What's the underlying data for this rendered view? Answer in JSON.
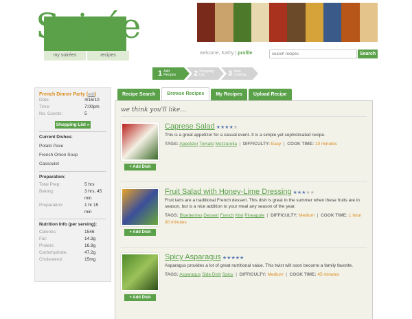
{
  "header": {
    "logo_text": "Soirée",
    "nav": [
      "my soirées",
      "recipes"
    ],
    "welcome_prefix": "welcome, Kathy",
    "profile_link": "profile",
    "search_placeholder": "search recipes",
    "search_button": "Search"
  },
  "steps": [
    {
      "num": "1",
      "label_1": "Add",
      "label_2": "Recipes"
    },
    {
      "num": "2",
      "label_1": "Shopping",
      "label_2": "List"
    },
    {
      "num": "3",
      "label_1": "Start",
      "label_2": "Cooking"
    }
  ],
  "sidebar": {
    "title": "French Dinner Party",
    "edit": "edit",
    "info": [
      {
        "k": "Date:",
        "v": "4/16/10"
      },
      {
        "k": "Time:",
        "v": "7:00pm"
      },
      {
        "k": "No. Guests:",
        "v": "5"
      }
    ],
    "shopping_button": "Shopping List »",
    "dishes_head": "Current Dishes:",
    "dishes": [
      "Potato Pave",
      "French Onion Soup",
      "Cassoulet"
    ],
    "prep_head": "Preparation:",
    "prep": [
      {
        "k": "Total Prep:",
        "v": "5 hrs"
      },
      {
        "k": "Baking:",
        "v": "3 hrs, 45 min"
      },
      {
        "k": "Preparation:",
        "v": "1 hr 15 min"
      }
    ],
    "nutrition_head": "Nutrition Info (per serving):",
    "nutrition": [
      {
        "k": "Calories:",
        "v": "1546"
      },
      {
        "k": "Fat:",
        "v": "14.3g"
      },
      {
        "k": "Protein:",
        "v": "16.9g"
      },
      {
        "k": "Carbohydrate:",
        "v": "47.2g"
      },
      {
        "k": "Cholesterol:",
        "v": "15mg"
      }
    ]
  },
  "tabs": [
    "Recipe Search",
    "Browse Recipes",
    "My Recipes",
    "Upload Recipe"
  ],
  "active_tab": 1,
  "suggest_heading": "we think you'll like...",
  "labels": {
    "tags": "TAGS:",
    "difficulty": "DIFFICULTY:",
    "cook_time": "COOK TIME:",
    "add_dish": "+ Add Dish"
  },
  "recipes": [
    {
      "title": "Caprese Salad",
      "stars": 4,
      "desc": "This is a great appetizer for a casual event. It is a simple yet sophisticated recipe.",
      "tags": [
        "Appetizer",
        "Tomato",
        "Mozzarella"
      ],
      "difficulty": "Easy",
      "cook_time": "10 minutes",
      "image_colors": [
        "#b8231e",
        "#f4f0e4",
        "#3c6b2a"
      ]
    },
    {
      "title": "Fruit Salad with Honey-Lime Dressing",
      "stars": 3,
      "desc": "Fruit tarts are a traditional French dessert. This dish is great in the summer when these fruits are in season, but is a nice addition to your meal any season of the year.",
      "tags": [
        "Blueberries",
        "Dessert",
        "French",
        "Kiwi",
        "Pineapple"
      ],
      "difficulty": "Medium",
      "cook_time": "1 hour 30 minutes",
      "image_colors": [
        "#e7a22a",
        "#3a4f9a",
        "#6aa83a"
      ]
    },
    {
      "title": "Spicy Asparagus",
      "stars": 5,
      "desc": "Asparagus provides a lot of great nutritional value. This twist will soon become a family favorite.",
      "tags": [
        "Asparagus",
        "Side Dish",
        "Spicy"
      ],
      "difficulty": "Medium",
      "cook_time": "45 minutes",
      "image_colors": [
        "#4f8a2a",
        "#9bc25a",
        "#2d4d18"
      ]
    }
  ],
  "colors": {
    "brand_green": "#5aa14a",
    "accent_orange": "#d98a1a",
    "star_blue": "#5a7bb0"
  },
  "banner_colors": [
    "#7a2a1a",
    "#c9a36b",
    "#4d7a2a",
    "#e8d8b0",
    "#a8321e",
    "#6b4a2a",
    "#d6a23a",
    "#3a5a8a",
    "#b8561a",
    "#e4c48a"
  ]
}
